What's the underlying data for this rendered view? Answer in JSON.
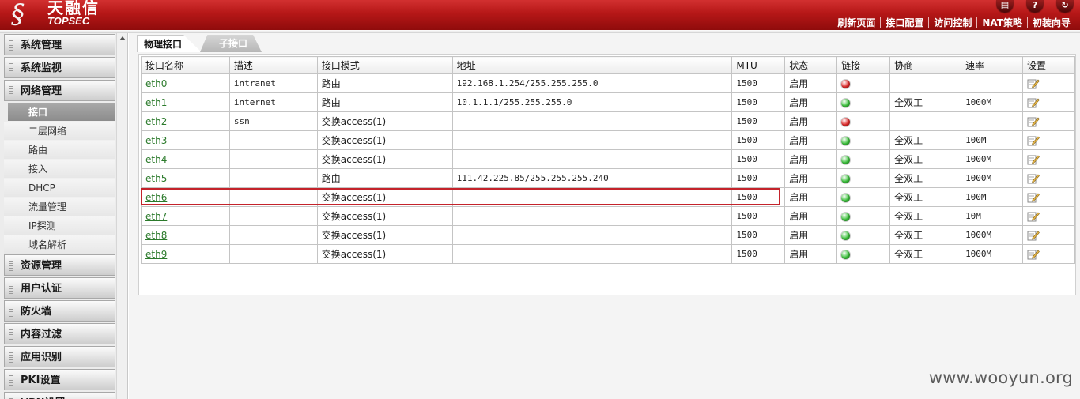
{
  "header": {
    "logo_cn": "天融信",
    "logo_en": "TOPSEC",
    "icons": [
      {
        "name": "save-icon",
        "glyph": "▤"
      },
      {
        "name": "help-icon",
        "glyph": "?"
      },
      {
        "name": "logout-icon",
        "glyph": "↻"
      }
    ],
    "nav": [
      "刷新页面",
      "接口配置",
      "访问控制",
      "NAT策略",
      "初装向导"
    ]
  },
  "sidebar": {
    "categories_top": [
      "系统管理",
      "系统监视",
      "网络管理"
    ],
    "network_sub": [
      "接口",
      "二层网络",
      "路由",
      "接入",
      "DHCP",
      "流量管理",
      "IP探测",
      "域名解析"
    ],
    "categories_bottom": [
      "资源管理",
      "用户认证",
      "防火墙",
      "内容过滤",
      "应用识别",
      "PKI设置",
      "VPN设置"
    ]
  },
  "tabs": {
    "physical": "物理接口",
    "sub": "子接口"
  },
  "table": {
    "headers": [
      "接口名称",
      "描述",
      "接口模式",
      "地址",
      "MTU",
      "状态",
      "链接",
      "协商",
      "速率",
      "设置"
    ],
    "rows": [
      {
        "name": "eth0",
        "desc": "intranet",
        "mode": "路由",
        "addr": "192.168.1.254/255.255.255.0",
        "mtu": "1500",
        "status": "启用",
        "link": "down",
        "nego": "",
        "speed": ""
      },
      {
        "name": "eth1",
        "desc": "internet",
        "mode": "路由",
        "addr": "10.1.1.1/255.255.255.0",
        "mtu": "1500",
        "status": "启用",
        "link": "up",
        "nego": "全双工",
        "speed": "1000M"
      },
      {
        "name": "eth2",
        "desc": "ssn",
        "mode": "交换access(1)",
        "addr": "",
        "mtu": "1500",
        "status": "启用",
        "link": "down",
        "nego": "",
        "speed": ""
      },
      {
        "name": "eth3",
        "desc": "",
        "mode": "交换access(1)",
        "addr": "",
        "mtu": "1500",
        "status": "启用",
        "link": "up",
        "nego": "全双工",
        "speed": "100M"
      },
      {
        "name": "eth4",
        "desc": "",
        "mode": "交换access(1)",
        "addr": "",
        "mtu": "1500",
        "status": "启用",
        "link": "up",
        "nego": "全双工",
        "speed": "1000M"
      },
      {
        "name": "eth5",
        "desc": "",
        "mode": "路由",
        "addr": "111.42.225.85/255.255.255.240",
        "mtu": "1500",
        "status": "启用",
        "link": "up",
        "nego": "全双工",
        "speed": "1000M"
      },
      {
        "name": "eth6",
        "desc": "",
        "mode": "交换access(1)",
        "addr": "",
        "mtu": "1500",
        "status": "启用",
        "link": "up",
        "nego": "全双工",
        "speed": "100M"
      },
      {
        "name": "eth7",
        "desc": "",
        "mode": "交换access(1)",
        "addr": "",
        "mtu": "1500",
        "status": "启用",
        "link": "up",
        "nego": "全双工",
        "speed": "10M"
      },
      {
        "name": "eth8",
        "desc": "",
        "mode": "交换access(1)",
        "addr": "",
        "mtu": "1500",
        "status": "启用",
        "link": "up",
        "nego": "全双工",
        "speed": "1000M"
      },
      {
        "name": "eth9",
        "desc": "",
        "mode": "交换access(1)",
        "addr": "",
        "mtu": "1500",
        "status": "启用",
        "link": "up",
        "nego": "全双工",
        "speed": "1000M"
      }
    ],
    "highlighted_row": "eth5"
  },
  "colors": {
    "header_red": "#b51717",
    "link_green": "#2b7a2b",
    "led_up": "#3cc43c",
    "led_down": "#e12a2a",
    "highlight": "#c4232b"
  },
  "watermark": "www.wooyun.org"
}
